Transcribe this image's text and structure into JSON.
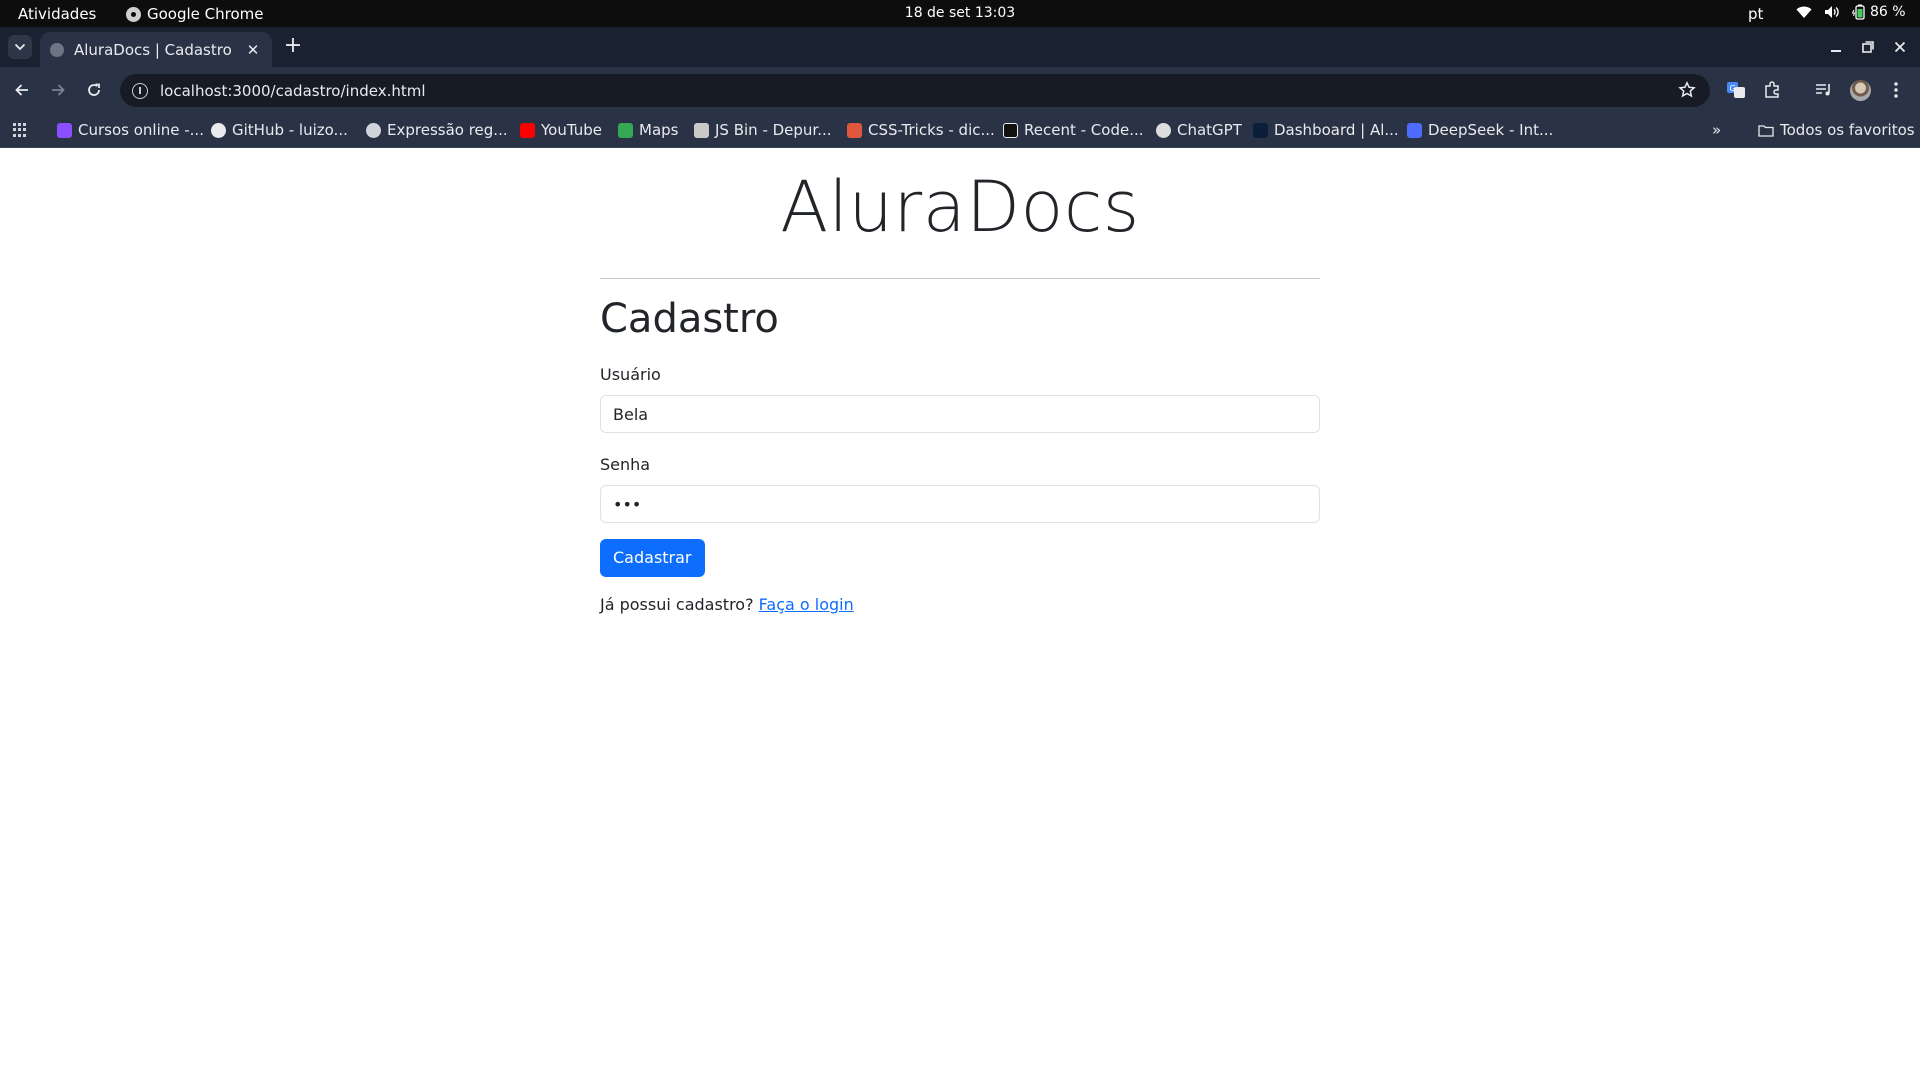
{
  "system_bar": {
    "activities": "Atividades",
    "app_name": "Google Chrome",
    "clock": "18 de set  13:03",
    "language": "pt",
    "battery": "86 %"
  },
  "browser": {
    "tab_title": "AluraDocs | Cadastro",
    "url": "localhost:3000/cadastro/index.html",
    "bookmarks": [
      {
        "label": "Cursos online -...",
        "icon": "alura-icon",
        "color": "#8c4fff"
      },
      {
        "label": "GitHub - luizo...",
        "icon": "github-icon",
        "color": "#e8eaed"
      },
      {
        "label": "Expressão reg...",
        "icon": "globe-icon",
        "color": "#cfd3da"
      },
      {
        "label": "YouTube",
        "icon": "youtube-icon",
        "color": "#ff0000"
      },
      {
        "label": "Maps",
        "icon": "maps-icon",
        "color": "#34a853"
      },
      {
        "label": "JS Bin - Depur...",
        "icon": "jsbin-icon",
        "color": "#c9c9c9"
      },
      {
        "label": "CSS-Tricks - dic...",
        "icon": "css-tricks-icon",
        "color": "#e0573f"
      },
      {
        "label": "Recent - Code...",
        "icon": "codepen-icon",
        "color": "#111111"
      },
      {
        "label": "ChatGPT",
        "icon": "chatgpt-icon",
        "color": "#dddddd"
      },
      {
        "label": "Dashboard | Al...",
        "icon": "alura-dashboard-icon",
        "color": "#0b1f3a"
      },
      {
        "label": "DeepSeek - Int...",
        "icon": "deepseek-icon",
        "color": "#4d6bfe"
      }
    ],
    "all_bookmarks": "Todos os favoritos"
  },
  "page": {
    "brand": "AluraDocs",
    "heading": "Cadastro",
    "username_label": "Usuário",
    "username_value": "Bela",
    "password_label": "Senha",
    "password_value": "•••",
    "submit_label": "Cadastrar",
    "login_prompt": "Já possui cadastro?",
    "login_link": "Faça o login"
  }
}
